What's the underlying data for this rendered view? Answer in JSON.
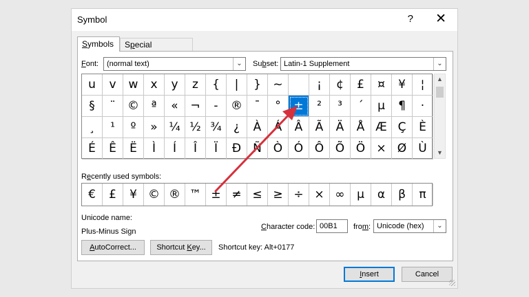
{
  "dialog": {
    "title": "Symbol",
    "help_glyph": "?",
    "close_glyph": "✕"
  },
  "tabs": [
    {
      "label_pre": "",
      "label_u": "S",
      "label_post": "ymbols"
    },
    {
      "label_pre": "S",
      "label_u": "p",
      "label_post": "ecial Characters"
    }
  ],
  "font": {
    "label_u": "F",
    "label_post": "ont:",
    "value": "(normal text)"
  },
  "subset": {
    "label_pre": "Su",
    "label_u": "b",
    "label_post": "set:",
    "value": "Latin-1 Supplement"
  },
  "symbol_rows": [
    [
      "u",
      "v",
      "w",
      "x",
      "y",
      "z",
      "{",
      "|",
      "}",
      "~",
      "",
      "¡",
      "¢",
      "£",
      "¤",
      "¥",
      "¦"
    ],
    [
      "§",
      "¨",
      "©",
      "ª",
      "«",
      "¬",
      "-",
      "®",
      "¯",
      "°",
      "±",
      "²",
      "³",
      "´",
      "µ",
      "¶",
      "·"
    ],
    [
      "¸",
      "¹",
      "º",
      "»",
      "¼",
      "½",
      "¾",
      "¿",
      "À",
      "Á",
      "Â",
      "Ã",
      "Ä",
      "Å",
      "Æ",
      "Ç",
      "È"
    ],
    [
      "É",
      "Ê",
      "Ë",
      "Ì",
      "Í",
      "Î",
      "Ï",
      "Ð",
      "Ñ",
      "Ò",
      "Ó",
      "Ô",
      "Õ",
      "Ö",
      "×",
      "Ø",
      "Ù"
    ]
  ],
  "selected_symbol": "±",
  "recent": {
    "label_pre": "R",
    "label_u": "e",
    "label_post": "cently used symbols:",
    "symbols": [
      "€",
      "£",
      "¥",
      "©",
      "®",
      "™",
      "±",
      "≠",
      "≤",
      "≥",
      "÷",
      "×",
      "∞",
      "µ",
      "α",
      "β",
      "π"
    ]
  },
  "unicode": {
    "label": "Unicode name:",
    "value": "Plus-Minus Sign"
  },
  "char_code": {
    "label_u": "C",
    "label_post": "haracter code:",
    "value": "00B1"
  },
  "from": {
    "label_pre": "fro",
    "label_u": "m",
    "label_post": ":",
    "value": "Unicode (hex)"
  },
  "buttons": {
    "autocorrect_u": "A",
    "autocorrect_post": "utoCorrect...",
    "shortcut_pre": "Shortcut ",
    "shortcut_u": "K",
    "shortcut_post": "ey...",
    "insert_u": "I",
    "insert_post": "nsert",
    "cancel": "Cancel"
  },
  "shortcut_key_text": "Shortcut key: Alt+0177",
  "colors": {
    "accent": "#0078d7",
    "arrow": "#d6303c"
  }
}
